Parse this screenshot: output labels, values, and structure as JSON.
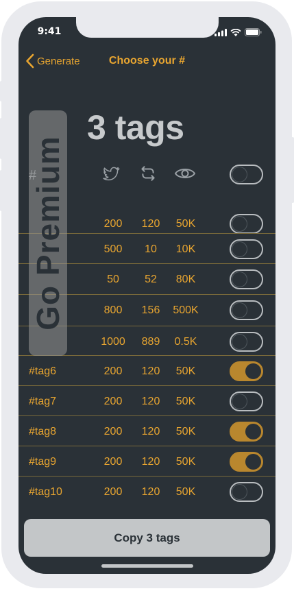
{
  "status": {
    "time": "9:41"
  },
  "nav": {
    "back_label": "Generate",
    "title": "Choose your #"
  },
  "count_label": "3 tags",
  "header": {
    "hash": "#",
    "icons": [
      "twitter-icon",
      "retweet-icon",
      "eye-icon"
    ]
  },
  "premium_label": "Go Premium",
  "rows": [
    {
      "tag": "",
      "likes": "200",
      "retweets": "120",
      "views": "50K",
      "selected": false
    },
    {
      "tag": "",
      "likes": "500",
      "retweets": "10",
      "views": "10K",
      "selected": false
    },
    {
      "tag": "",
      "likes": "50",
      "retweets": "52",
      "views": "80K",
      "selected": false
    },
    {
      "tag": "",
      "likes": "800",
      "retweets": "156",
      "views": "500K",
      "selected": false
    },
    {
      "tag": "",
      "likes": "1000",
      "retweets": "889",
      "views": "0.5K",
      "selected": false
    },
    {
      "tag": "#tag6",
      "likes": "200",
      "retweets": "120",
      "views": "50K",
      "selected": true
    },
    {
      "tag": "#tag7",
      "likes": "200",
      "retweets": "120",
      "views": "50K",
      "selected": false
    },
    {
      "tag": "#tag8",
      "likes": "200",
      "retweets": "120",
      "views": "50K",
      "selected": true
    },
    {
      "tag": "#tag9",
      "likes": "200",
      "retweets": "120",
      "views": "50K",
      "selected": true
    },
    {
      "tag": "#tag10",
      "likes": "200",
      "retweets": "120",
      "views": "50K",
      "selected": false
    }
  ],
  "copy_button": "Copy 3 tags",
  "colors": {
    "background": "#2a3137",
    "accent": "#e8a530",
    "toggle_on": "#b9872e"
  }
}
